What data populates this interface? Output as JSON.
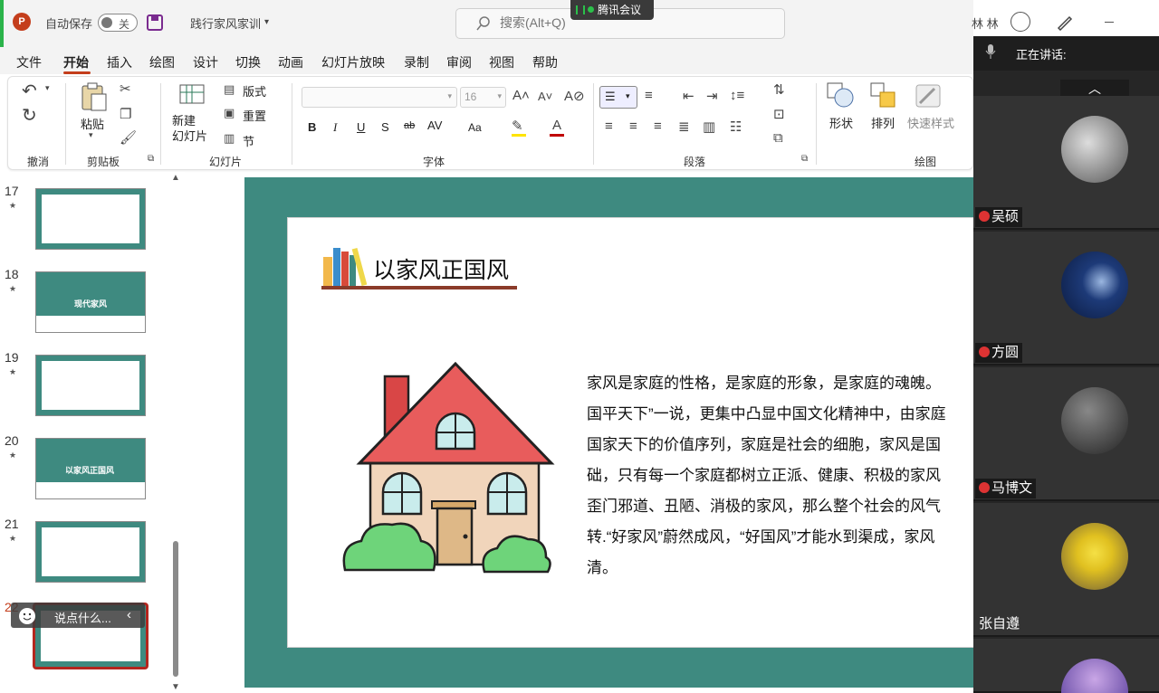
{
  "titlebar": {
    "app_logo": "P",
    "autosave_label": "自动保存",
    "autosave_state": "关",
    "doc_title": "践行家风家训",
    "search_placeholder": "搜索(Alt+Q)",
    "meeting_app": "腾讯会议",
    "user_name": "林 林"
  },
  "menu": {
    "items": [
      "文件",
      "开始",
      "插入",
      "绘图",
      "设计",
      "切换",
      "动画",
      "幻灯片放映",
      "录制",
      "审阅",
      "视图",
      "帮助"
    ],
    "active": "开始"
  },
  "ribbon": {
    "groups": {
      "undo": "撤消",
      "clipboard": "剪贴板",
      "slides": "幻灯片",
      "font": "字体",
      "paragraph": "段落",
      "drawing": "绘图"
    },
    "paste_label": "粘贴",
    "new_slide_label": "新建\n幻灯片",
    "layout_label": "版式",
    "reset_label": "重置",
    "section_label": "节",
    "font_size": "16",
    "shape_label": "形状",
    "arrange_label": "排列",
    "quick_style_label": "快速样式",
    "btn_bold": "B",
    "btn_italic": "I",
    "btn_underline": "U",
    "btn_strike": "S",
    "btn_abc": "ab",
    "btn_spacing": "AV",
    "btn_case": "Aa"
  },
  "slides_pane": {
    "thumbs": [
      {
        "num": "17",
        "title": ""
      },
      {
        "num": "18",
        "title": "现代家风"
      },
      {
        "num": "19",
        "title": ""
      },
      {
        "num": "20",
        "title": "以家风正国风"
      },
      {
        "num": "21",
        "title": ""
      },
      {
        "num": "22",
        "title": ""
      }
    ],
    "chat_placeholder": "说点什么..."
  },
  "slide": {
    "title": "以家风正国风",
    "body": "家风是家庭的性格，是家庭的形象，是家庭的魂魄。\n国平天下”一说，更集中凸显中国文化精神中，由家庭\n国家天下的价值序列，家庭是社会的细胞，家风是国\n础，只有每一个家庭都树立正派、健康、积极的家风\n歪门邪道、丑陋、消极的家风，那么整个社会的风气\n转.“好家风”蔚然成风，“好国风”才能水到渠成，家风\n清。"
  },
  "panel": {
    "speaking_label": "正在讲话:",
    "participants": [
      {
        "name": "吴硕",
        "muted": true
      },
      {
        "name": "方圆",
        "muted": true
      },
      {
        "name": "马博文",
        "muted": true
      },
      {
        "name": "张自遵",
        "muted": false
      }
    ]
  },
  "colors": {
    "accent": "#c43e1c",
    "slide_border": "#3e8a80",
    "panel_bg": "#262626"
  }
}
